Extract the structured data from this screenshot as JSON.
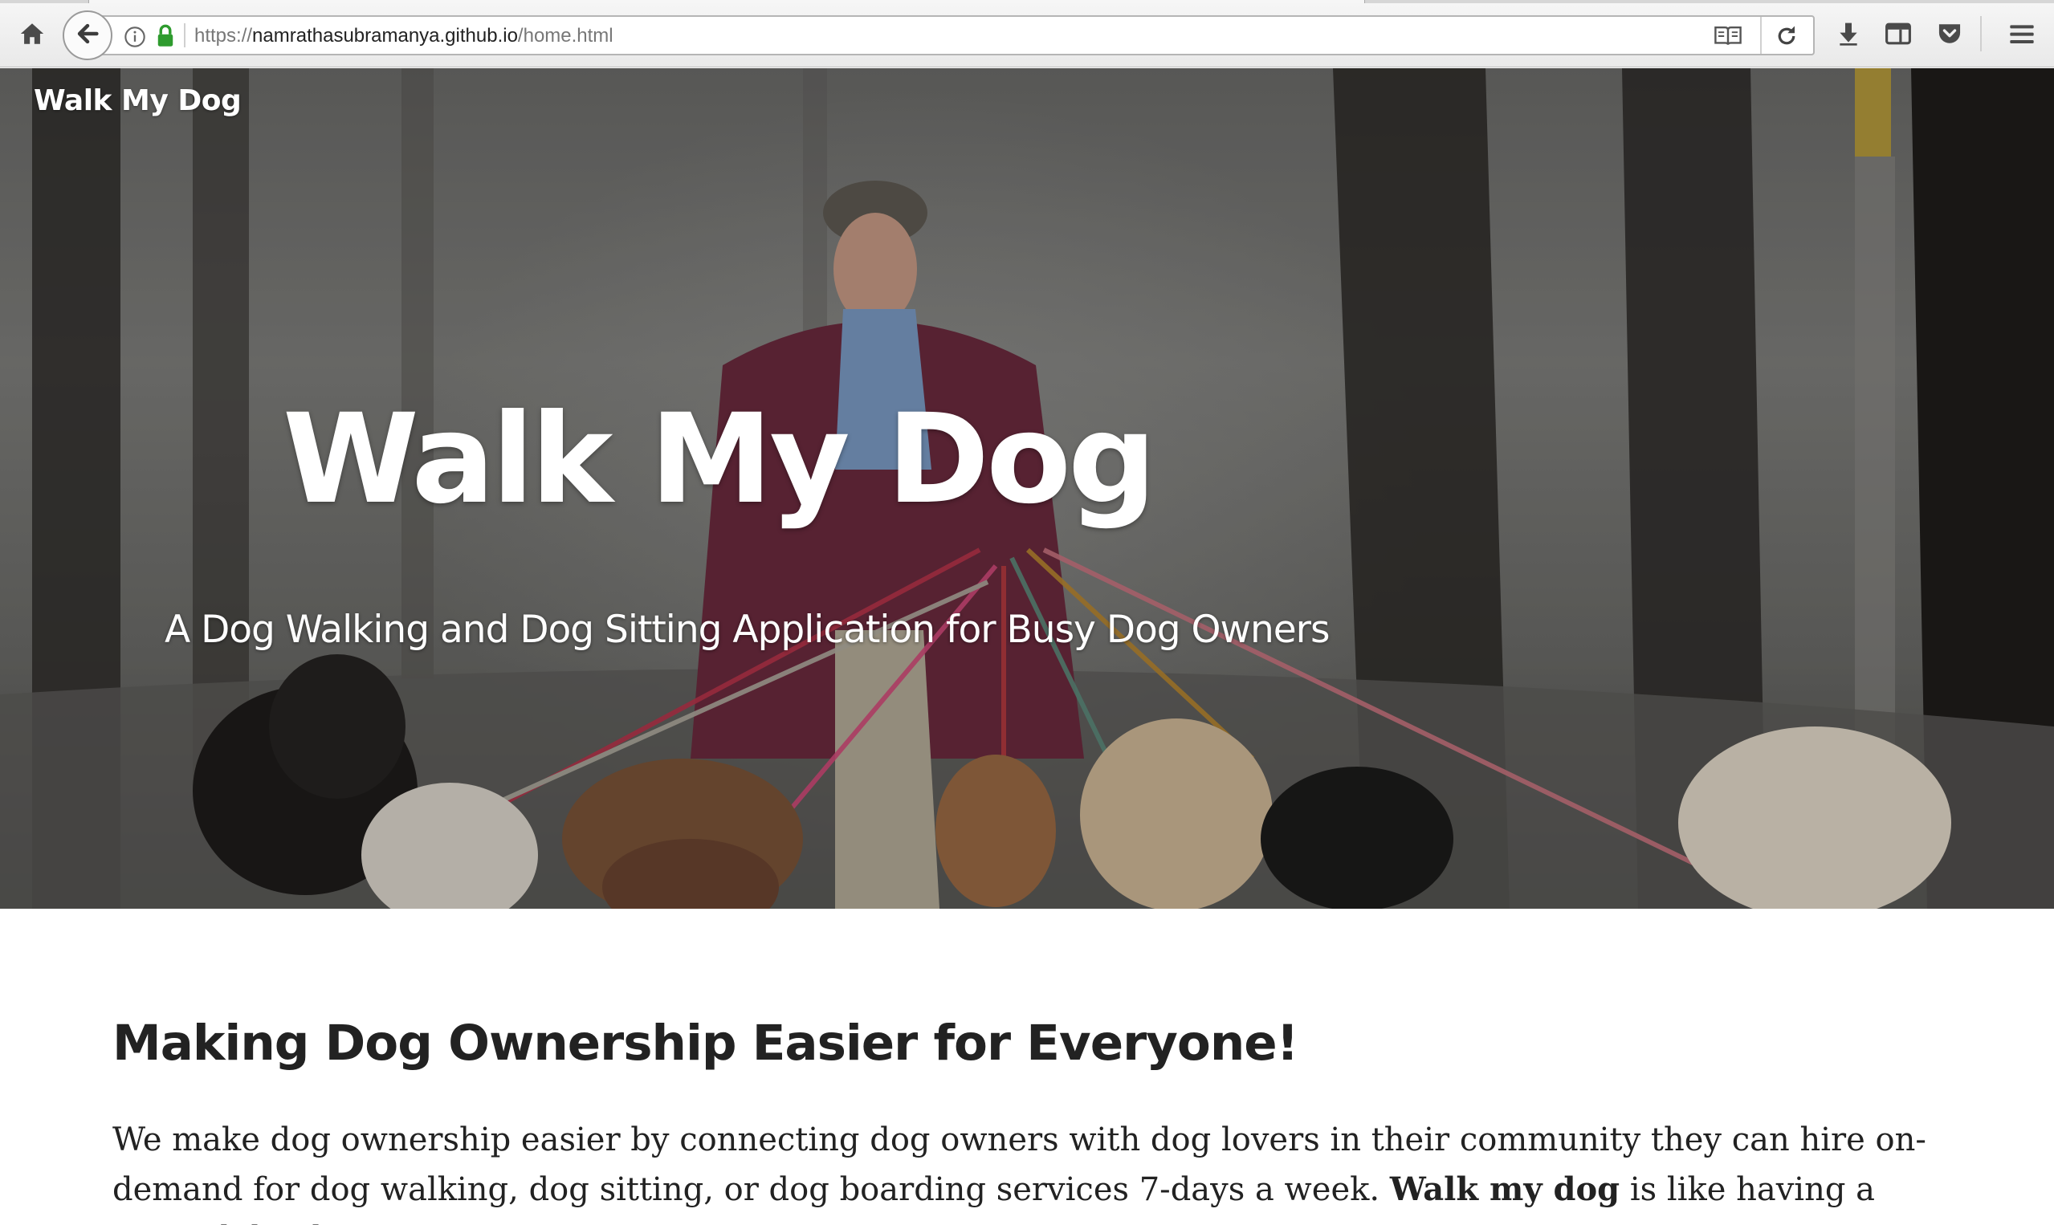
{
  "browser": {
    "url_prefix": "https://",
    "url_host": "namrathasubramanya.github.io",
    "url_path": "/home.html",
    "icons": {
      "home": "home-icon",
      "back": "back-arrow-icon",
      "info": "info-icon",
      "lock": "lock-icon",
      "reader": "reader-view-icon",
      "reload": "reload-icon",
      "download": "download-icon",
      "sidebar": "sidebar-icon",
      "pocket": "pocket-icon",
      "menu": "hamburger-menu-icon"
    },
    "lock_color": "#2e9b2e"
  },
  "site": {
    "brand": "Walk My Dog"
  },
  "hero": {
    "title": "Walk My Dog",
    "subtitle": "A Dog Walking and Dog Sitting Application for Busy Dog Owners",
    "image_description_icon": "dog-walker-photo"
  },
  "main": {
    "heading": "Making Dog Ownership Easier for Everyone!",
    "intro_part1": "We make dog ownership easier by connecting dog owners with dog lovers in their community they can hire on-demand for dog walking, dog sitting, or dog boarding services 7-days a week. ",
    "intro_bold": "Walk my dog",
    "intro_part2": " is like having a trusted dog-loving"
  },
  "colors": {
    "text": "#222222",
    "hero_text": "#ffffff"
  }
}
